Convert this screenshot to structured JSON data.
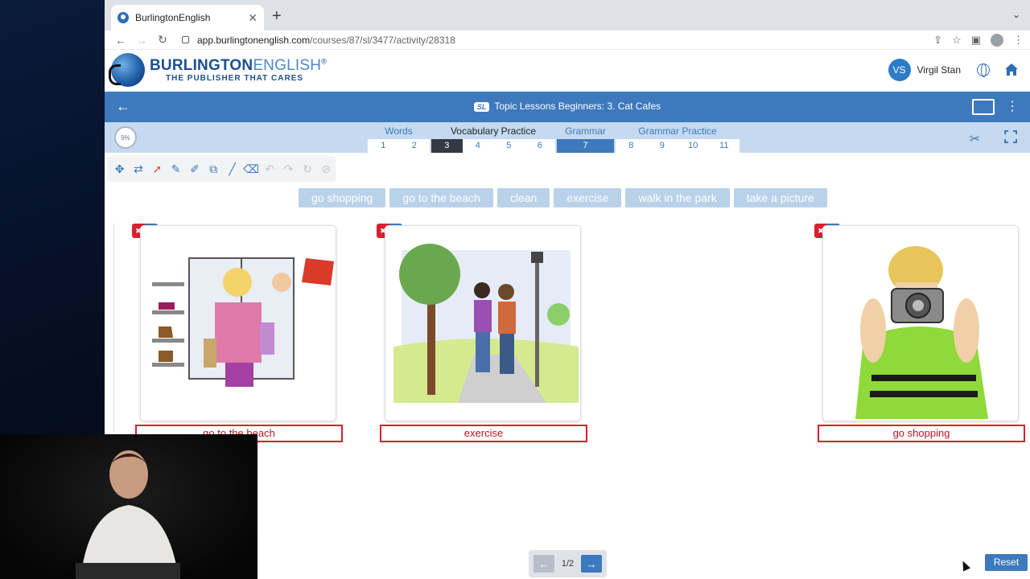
{
  "browser": {
    "tab_title": "BurlingtonEnglish",
    "tab_close": "✕",
    "new_tab": "+",
    "url_host": "app.burlingtonenglish.com",
    "url_path": "/courses/87/sl/3477/activity/28318"
  },
  "header": {
    "brand_main": "BURLINGTON",
    "brand_light": "ENGLISH",
    "brand_mark": "®",
    "tagline": "THE PUBLISHER THAT CARES",
    "user_initials": "VS",
    "user_name": "Virgil Stan"
  },
  "titlebar": {
    "badge": "SL",
    "title": "Topic Lessons Beginners: 3. Cat Cafes"
  },
  "steps": {
    "progress": "9%",
    "groups": [
      {
        "label": "Words",
        "nums": [
          "1",
          "2"
        ]
      },
      {
        "label": "Vocabulary Practice",
        "nums": [
          "3",
          "4",
          "5",
          "6"
        ]
      },
      {
        "label": "Grammar",
        "nums": [
          "7"
        ]
      },
      {
        "label": "Grammar Practice",
        "nums": [
          "8",
          "9",
          "10",
          "11"
        ]
      }
    ],
    "current": "3",
    "selected": "7"
  },
  "chips": [
    "go shopping",
    "go to the beach",
    "clean",
    "exercise",
    "walk in the park",
    "take a picture"
  ],
  "cards": [
    {
      "number": "2",
      "answer": "go to the beach",
      "picture": "shopping-illustration"
    },
    {
      "number": "3",
      "answer": "exercise",
      "picture": "park-walk-illustration"
    },
    {
      "number": "4",
      "answer": "go shopping",
      "picture": "camera-photo-illustration"
    }
  ],
  "pager": {
    "text": "1/2",
    "prev": "←",
    "next": "→"
  },
  "reset_label": "Reset",
  "colors": {
    "brand_blue": "#3d79bc",
    "error_red": "#d8202f",
    "chip_bg": "#b9d2ea"
  }
}
